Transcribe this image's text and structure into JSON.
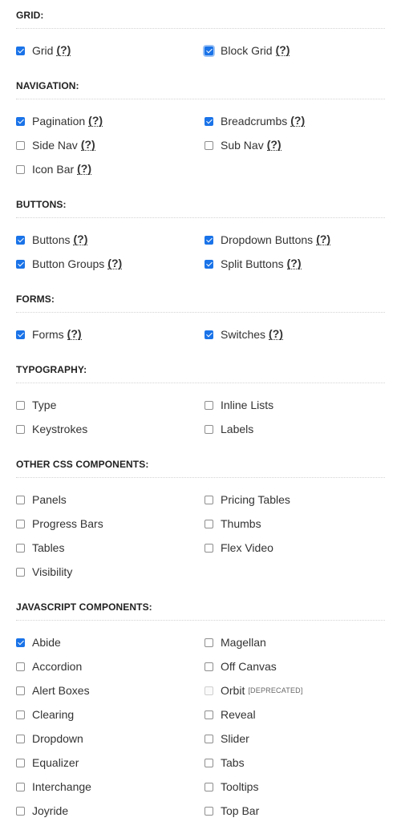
{
  "help_text": "(?)",
  "sections": [
    {
      "title": "GRID:",
      "items": [
        {
          "label": "Grid",
          "checked": true,
          "help": true
        },
        {
          "label": "Block Grid",
          "checked": true,
          "help": true,
          "focused": true
        }
      ]
    },
    {
      "title": "NAVIGATION:",
      "items": [
        {
          "label": "Pagination",
          "checked": true,
          "help": true
        },
        {
          "label": "Breadcrumbs",
          "checked": true,
          "help": true
        },
        {
          "label": "Side Nav",
          "checked": false,
          "help": true
        },
        {
          "label": "Sub Nav",
          "checked": false,
          "help": true
        },
        {
          "label": "Icon Bar",
          "checked": false,
          "help": true
        }
      ]
    },
    {
      "title": "BUTTONS:",
      "items": [
        {
          "label": "Buttons",
          "checked": true,
          "help": true
        },
        {
          "label": "Dropdown Buttons",
          "checked": true,
          "help": true
        },
        {
          "label": "Button Groups",
          "checked": true,
          "help": true
        },
        {
          "label": "Split Buttons",
          "checked": true,
          "help": true
        }
      ]
    },
    {
      "title": "FORMS:",
      "items": [
        {
          "label": "Forms",
          "checked": true,
          "help": true
        },
        {
          "label": "Switches",
          "checked": true,
          "help": true
        }
      ]
    },
    {
      "title": "TYPOGRAPHY:",
      "items": [
        {
          "label": "Type",
          "checked": false
        },
        {
          "label": "Inline Lists",
          "checked": false
        },
        {
          "label": "Keystrokes",
          "checked": false
        },
        {
          "label": "Labels",
          "checked": false
        }
      ]
    },
    {
      "title": "OTHER CSS COMPONENTS:",
      "items": [
        {
          "label": "Panels",
          "checked": false
        },
        {
          "label": "Pricing Tables",
          "checked": false
        },
        {
          "label": "Progress Bars",
          "checked": false
        },
        {
          "label": "Thumbs",
          "checked": false
        },
        {
          "label": "Tables",
          "checked": false
        },
        {
          "label": "Flex Video",
          "checked": false
        },
        {
          "label": "Visibility",
          "checked": false
        }
      ]
    },
    {
      "title": "JAVASCRIPT COMPONENTS:",
      "items": [
        {
          "label": "Abide",
          "checked": true
        },
        {
          "label": "Magellan",
          "checked": false
        },
        {
          "label": "Accordion",
          "checked": false
        },
        {
          "label": "Off Canvas",
          "checked": false
        },
        {
          "label": "Alert Boxes",
          "checked": false
        },
        {
          "label": "Orbit",
          "checked": false,
          "disabled": true,
          "tag": "[DEPRECATED]"
        },
        {
          "label": "Clearing",
          "checked": false
        },
        {
          "label": "Reveal",
          "checked": false
        },
        {
          "label": "Dropdown",
          "checked": false
        },
        {
          "label": "Slider",
          "checked": false
        },
        {
          "label": "Equalizer",
          "checked": false
        },
        {
          "label": "Tabs",
          "checked": false
        },
        {
          "label": "Interchange",
          "checked": false
        },
        {
          "label": "Tooltips",
          "checked": false
        },
        {
          "label": "Joyride",
          "checked": false
        },
        {
          "label": "Top Bar",
          "checked": false
        }
      ]
    }
  ]
}
